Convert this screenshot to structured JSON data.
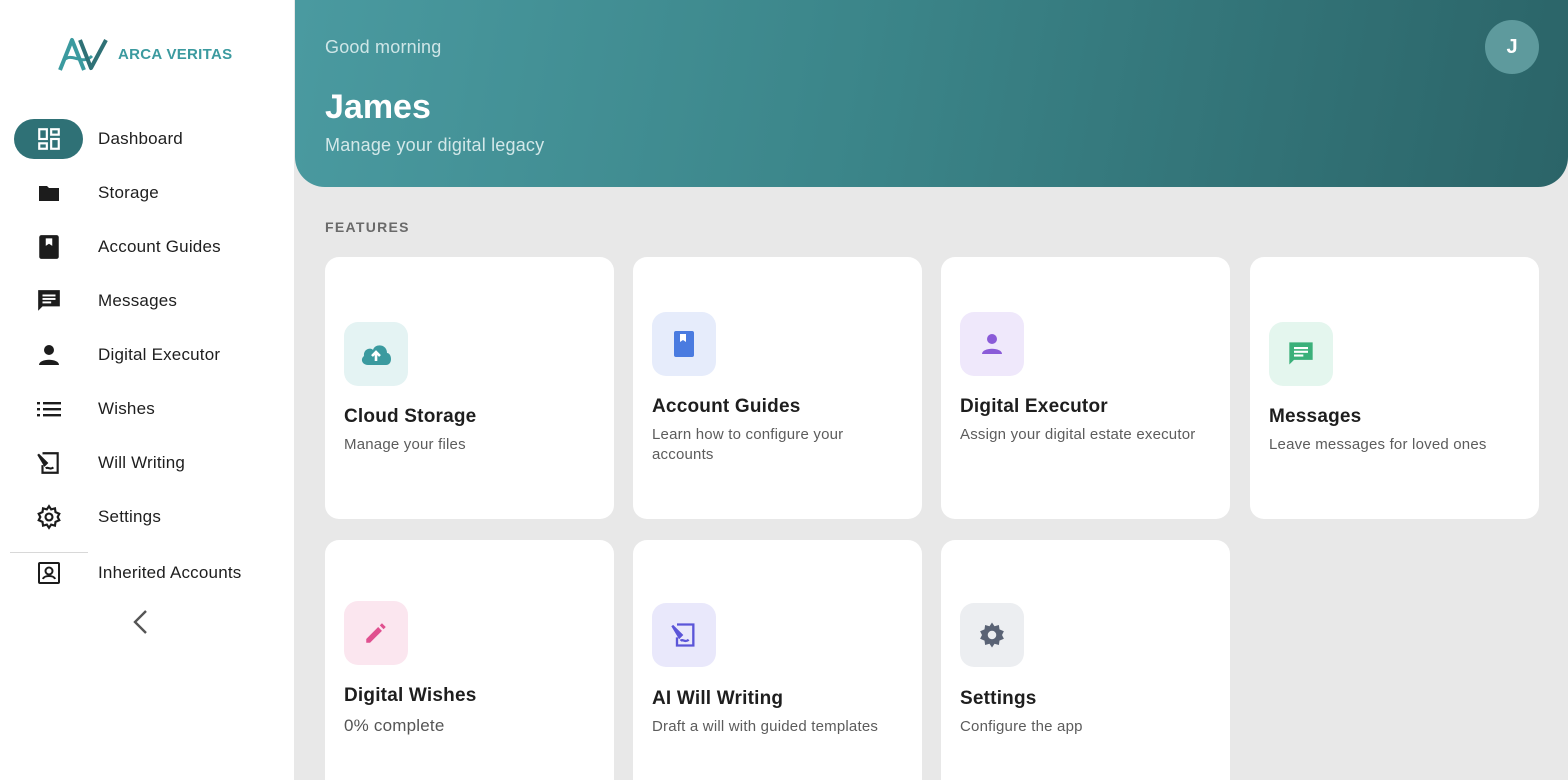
{
  "brand": {
    "name": "ARCA VERITAS",
    "color": "#3b9a9f"
  },
  "sidebar": {
    "items": [
      {
        "label": "Dashboard",
        "icon": "dashboard-icon",
        "active": true
      },
      {
        "label": "Storage",
        "icon": "folder-icon"
      },
      {
        "label": "Account Guides",
        "icon": "bookmark-book-icon"
      },
      {
        "label": "Messages",
        "icon": "chat-icon"
      },
      {
        "label": "Digital Executor",
        "icon": "person-icon"
      },
      {
        "label": "Wishes",
        "icon": "list-icon"
      },
      {
        "label": "Will Writing",
        "icon": "document-sign-icon"
      },
      {
        "label": "Settings",
        "icon": "gear-icon"
      },
      {
        "label": "Inherited Accounts",
        "icon": "account-box-icon"
      }
    ],
    "collapse_icon": "chevron-left-icon"
  },
  "header": {
    "greeting": "Good morning",
    "name": "James",
    "tagline": "Manage your digital legacy",
    "avatar_initial": "J"
  },
  "features": {
    "section_title": "FEATURES",
    "cards": [
      {
        "title": "Cloud Storage",
        "desc": "Manage your files",
        "icon": "cloud-upload-icon",
        "accent": "#3b9a9f"
      },
      {
        "title": "Account Guides",
        "desc": "Learn how to configure your accounts",
        "icon": "book-icon",
        "accent": "#4a7be0"
      },
      {
        "title": "Digital Executor",
        "desc": "Assign your digital estate executor",
        "icon": "person-icon",
        "accent": "#8a5bd8"
      },
      {
        "title": "Messages",
        "desc": "Leave messages for loved ones",
        "icon": "message-icon",
        "accent": "#3bb07a"
      },
      {
        "title": "Digital Wishes",
        "desc": "0% complete",
        "icon": "pencil-icon",
        "accent": "#e0508f"
      },
      {
        "title": "AI Will Writing",
        "desc": "Draft a will with guided templates",
        "icon": "document-sign-icon",
        "accent": "#5b55d8"
      },
      {
        "title": "Settings",
        "desc": "Configure the app",
        "icon": "gear-icon",
        "accent": "#5a6375"
      }
    ]
  }
}
